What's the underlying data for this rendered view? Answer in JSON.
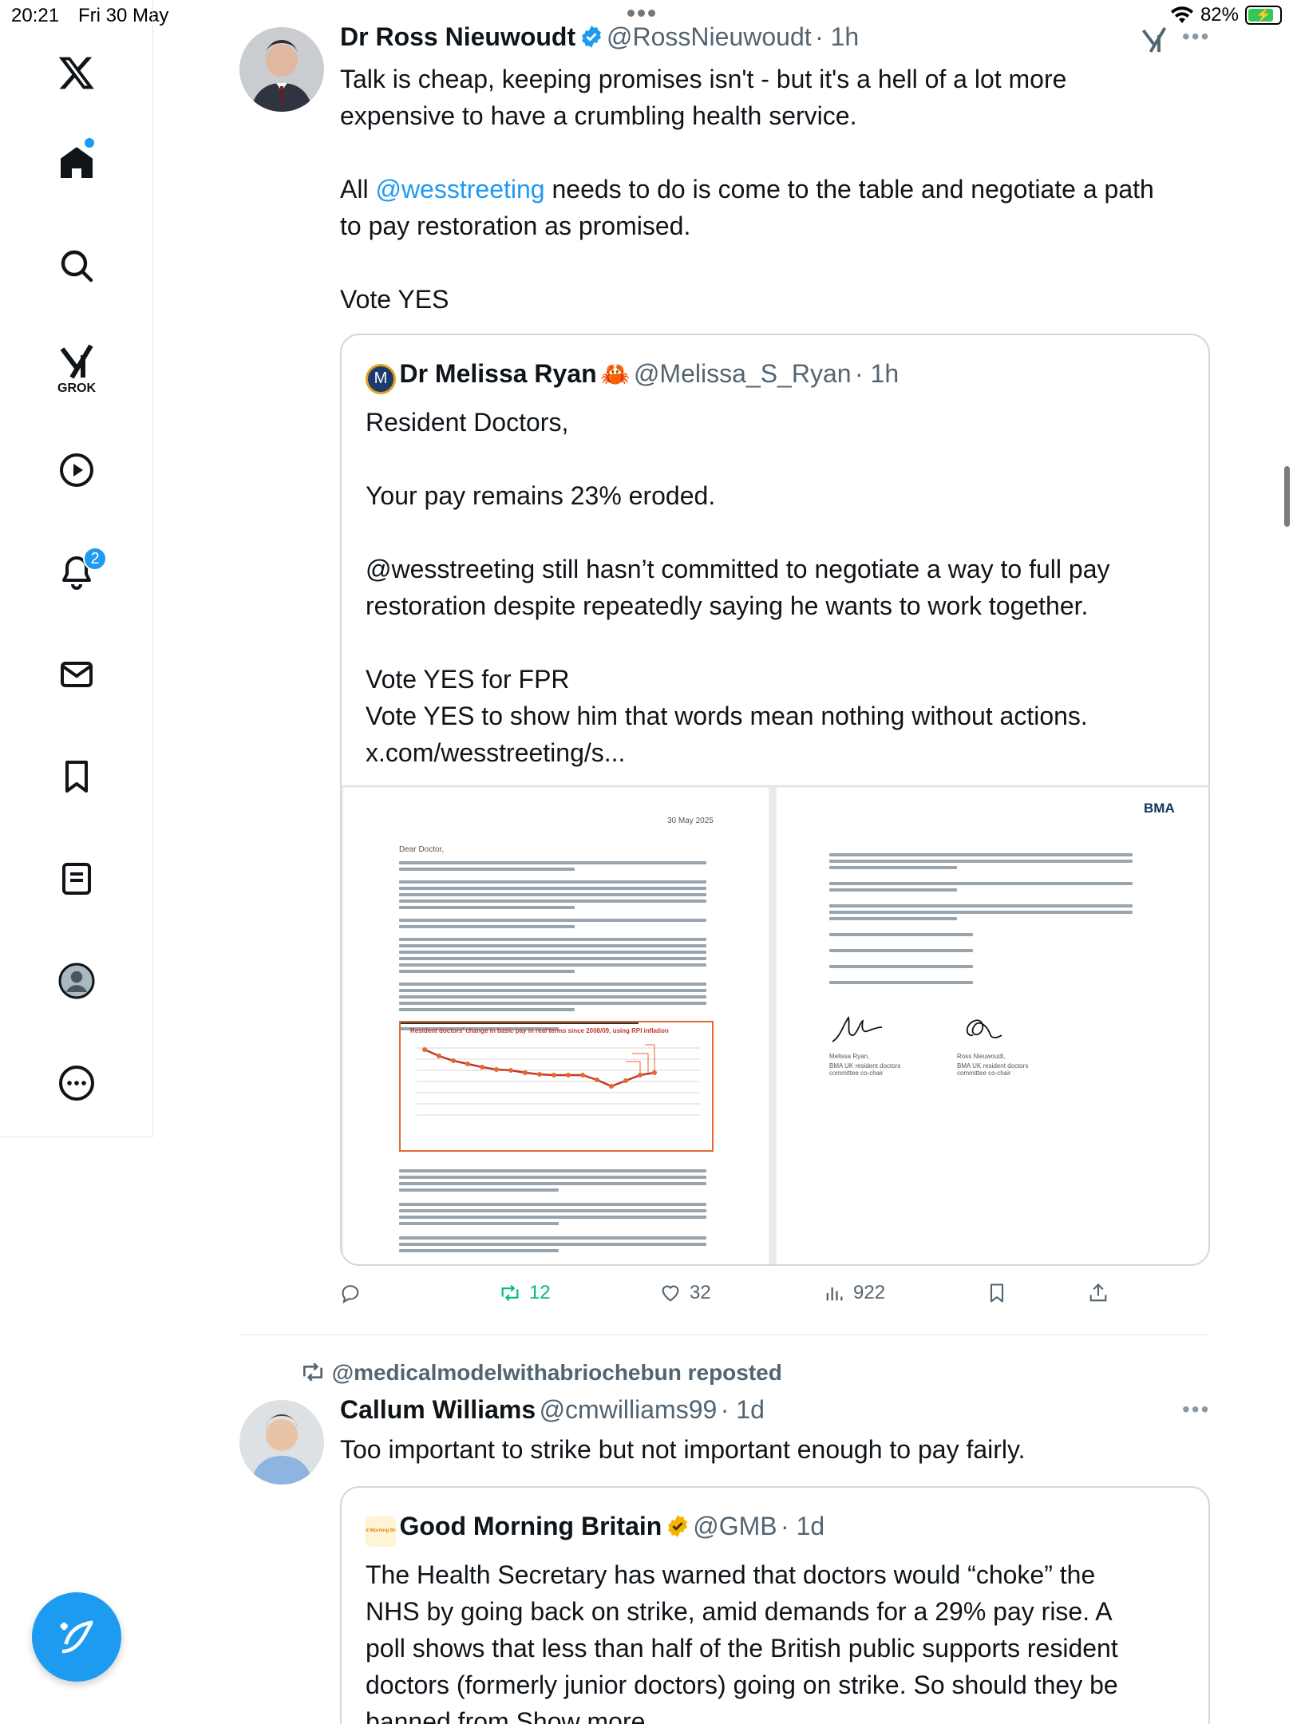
{
  "status": {
    "time": "20:21",
    "date": "Fri 30 May",
    "battery": "82%",
    "battery_level": 0.82
  },
  "sidebar": {
    "grok_label": "GROK",
    "notifications_count": "2",
    "icons": [
      "x-logo-icon",
      "home-icon",
      "search-icon",
      "grok-icon",
      "video-icon",
      "notifications-icon",
      "messages-icon",
      "bookmarks-icon",
      "lists-icon",
      "profile-icon",
      "more-icon",
      "compose-icon"
    ]
  },
  "tweet1": {
    "name": "Dr Ross Nieuwoudt",
    "handle": "@RossNieuwoudt",
    "time": "· 1h",
    "lines": [
      "Talk is cheap, keeping promises isn't - but it's a hell of a lot more",
      "expensive to have a crumbling health service."
    ],
    "line3_pre": "All ",
    "line3_mention": "@wesstreeting",
    "line3_post": " needs to do is come to the table and negotiate a path",
    "line4": "to pay restoration as promised.",
    "line5": "Vote YES",
    "quote": {
      "name": "Dr Melissa Ryan",
      "emoji": "🦀",
      "handle": "@Melissa_S_Ryan",
      "time": "· 1h",
      "avatar_letter": "M",
      "text": [
        "Resident Doctors,",
        "Your pay remains 23% eroded.",
        "@wesstreeting still hasn’t committed to negotiate a way to full pay",
        "restoration despite repeatedly saying he wants to work together.",
        "Vote YES for FPR",
        "Vote YES to show him that words mean nothing without actions.",
        "x.com/wesstreeting/s..."
      ],
      "letter_left": {
        "date": "30 May 2025",
        "salutation": "Dear Doctor,",
        "chart_title": "Resident doctors' change in basic pay in real terms since 2008/09, using RPI inflation"
      },
      "letter_right": {
        "logo": "BMA",
        "sign1": "Melissa Ryan,",
        "sign1_role": "BMA UK resident doctors committee co-chair",
        "sign2": "Ross Nieuwoudt,",
        "sign2_role": "BMA UK resident doctors committee co-chair"
      }
    },
    "actions": {
      "reposts": "12",
      "likes": "32",
      "views": "922"
    }
  },
  "tweet2": {
    "reposted_by": "@medicalmodelwithabriochebun reposted",
    "name": "Callum Williams",
    "handle": "@cmwilliams99",
    "time": "· 1d",
    "text": "Too important to strike but not important enough to pay fairly.",
    "quote": {
      "name": "Good Morning Britain",
      "handle": "@GMB",
      "time": "· 1d",
      "avatar_text": "Good Morning Britain",
      "text": [
        "The Health Secretary has warned that doctors would “choke” the",
        "NHS by going back on strike, amid demands for a 29% pay rise. A",
        "poll shows that less than half of the British public supports resident",
        "doctors (formerly junior doctors) going on strike. So should they be"
      ],
      "last_line_pre": "banned from ",
      "show_more": "Show more"
    }
  },
  "colors": {
    "accent": "#1d9bf0",
    "repost_green": "#00ba7c",
    "text": "#0f1419",
    "muted": "#536471",
    "chart_orange": "#e26a2c",
    "gold": "#f4b400"
  }
}
